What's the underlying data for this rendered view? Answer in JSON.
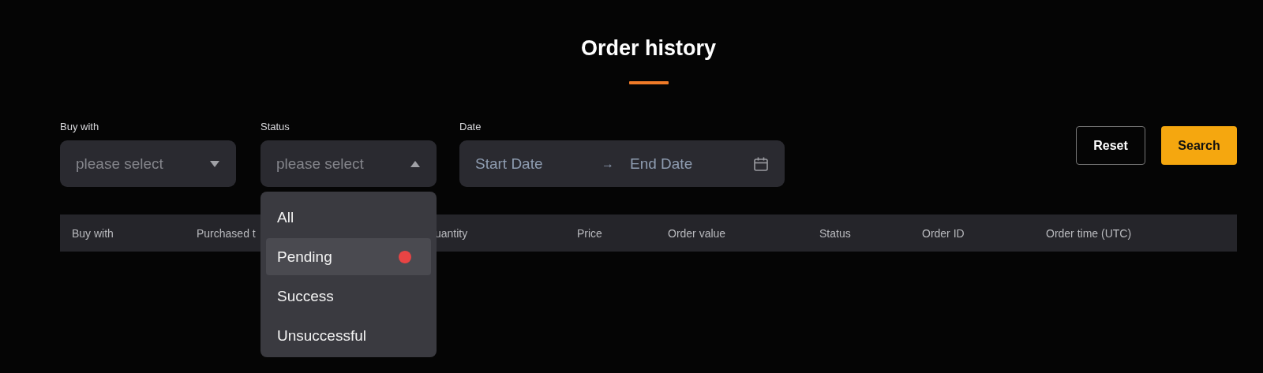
{
  "title": "Order history",
  "filters": [
    {
      "kind": "select",
      "label": "Buy with",
      "placeholder": "please select",
      "open": false
    },
    {
      "kind": "select",
      "label": "Status",
      "placeholder": "please select",
      "open": true,
      "options": [
        {
          "label": "All",
          "highlighted": false
        },
        {
          "label": "Pending",
          "highlighted": true
        },
        {
          "label": "Success",
          "highlighted": false
        },
        {
          "label": "Unsuccessful",
          "highlighted": false
        }
      ]
    },
    {
      "kind": "daterange",
      "label": "Date",
      "start_placeholder": "Start Date",
      "separator": "→",
      "end_placeholder": "End Date"
    }
  ],
  "buttons": [
    {
      "kind": "outline",
      "label": "Reset"
    },
    {
      "kind": "primary",
      "label": "Search"
    }
  ],
  "table": {
    "columns": [
      "Buy with",
      "Purchased t",
      "uantity",
      "Price",
      "Order value",
      "Status",
      "Order ID",
      "Order time (UTC)"
    ]
  }
}
